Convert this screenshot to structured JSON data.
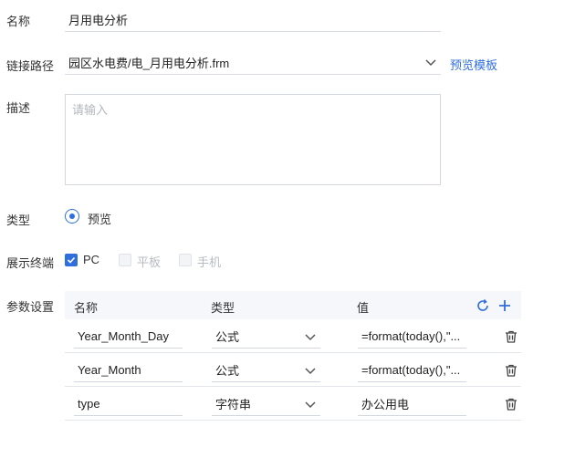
{
  "form": {
    "name_label": "名称",
    "name_value": "月用电分析",
    "path_label": "链接路径",
    "path_value": "园区水电费/电_月用电分析.frm",
    "preview_template_link": "预览模板",
    "desc_label": "描述",
    "desc_placeholder": "请输入",
    "type_label": "类型",
    "type_option": "预览",
    "terminal_label": "展示终端",
    "terminals": [
      {
        "label": "PC",
        "checked": true
      },
      {
        "label": "平板",
        "checked": false
      },
      {
        "label": "手机",
        "checked": false
      }
    ],
    "params_label": "参数设置"
  },
  "params": {
    "headers": {
      "name": "名称",
      "type": "类型",
      "value": "值"
    },
    "rows": [
      {
        "name": "Year_Month_Day",
        "type": "公式",
        "value": "=format(today(),\"..."
      },
      {
        "name": "Year_Month",
        "type": "公式",
        "value": "=format(today(),\"..."
      },
      {
        "name": "type",
        "type": "字符串",
        "value": "办公用电"
      }
    ]
  },
  "colors": {
    "accent": "#2f6fdc",
    "border": "#d9dde3",
    "header_bg": "#f5f7fa"
  },
  "icons": {
    "dropdown": "chevron-down-icon",
    "refresh": "refresh-icon",
    "add": "plus-icon",
    "delete": "trash-icon"
  }
}
